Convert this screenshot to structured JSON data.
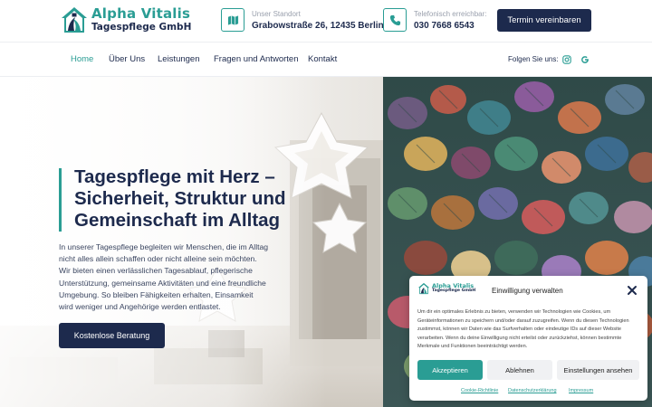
{
  "brand": {
    "name": "Alpha Vitalis",
    "subtitle": "Tagespflege GmbH",
    "primary_color": "#1d2a4d",
    "accent_color": "#2a9d94"
  },
  "header": {
    "location_label": "Unser Standort",
    "location_value": "Grabowstraße 26, 12435 Berlin",
    "phone_label": "Telefonisch erreichbar:",
    "phone_value": "030 7668 6543",
    "cta": "Termin vereinbaren"
  },
  "nav": {
    "items": [
      {
        "label": "Home",
        "active": true
      },
      {
        "label": "Über Uns"
      },
      {
        "label": "Leistungen"
      },
      {
        "label": "Fragen und Antworten"
      },
      {
        "label": "Kontakt"
      }
    ],
    "follow_label": "Folgen Sie uns:",
    "social_icons": [
      "instagram-icon",
      "google-icon"
    ]
  },
  "hero": {
    "title": "Tagespflege mit Herz – Sicherheit, Struktur und Gemeinschaft im Alltag",
    "text": "In unserer Tagespflege begleiten wir Menschen, die im Alltag nicht alles allein schaffen oder nicht alleine sein möchten. Wir bieten einen verlässlichen Tagesablauf, pflegerische Unterstützung, gemeinsame Aktivitäten und eine freundliche Umgebung. So bleiben Fähigkeiten erhalten, Einsamkeit wird weniger und Angehörige werden entlastet.",
    "cta": "Kostenlose Beratung"
  },
  "consent": {
    "title": "Einwilligung verwalten",
    "text": "Um dir ein optimales Erlebnis zu bieten, verwenden wir Technologien wie Cookies, um Geräteinformationen zu speichern und/oder darauf zuzugreifen. Wenn du diesen Technologien zustimmst, können wir Daten wie das Surfverhalten oder eindeutige IDs auf dieser Website verarbeiten. Wenn du deine Einwilligung nicht erteilst oder zurückziehst, können bestimmte Merkmale und Funktionen beeinträchtigt werden.",
    "accept": "Akzeptieren",
    "deny": "Ablehnen",
    "settings": "Einstellungen ansehen",
    "links": [
      "Cookie-Richtlinie",
      "Datenschutzerklärung",
      "Impressum"
    ]
  }
}
